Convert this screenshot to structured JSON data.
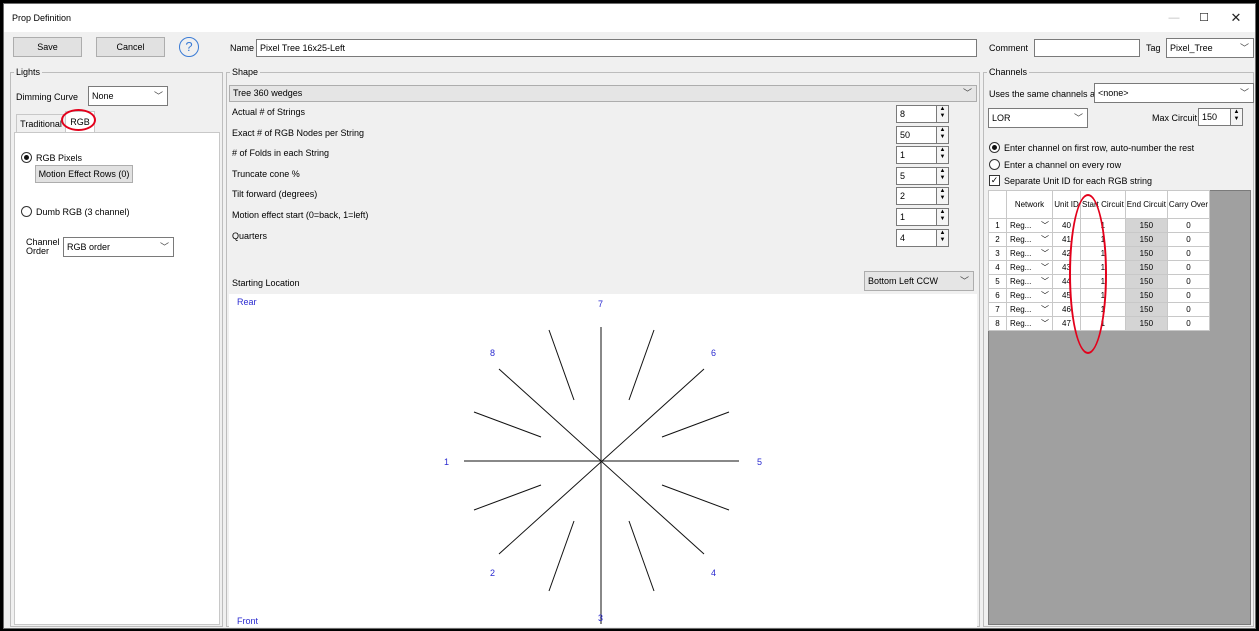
{
  "window": {
    "title": "Prop Definition",
    "min_icon": "—",
    "max_icon": "☐",
    "close_icon": "✕"
  },
  "toolbar": {
    "save_label": "Save",
    "cancel_label": "Cancel",
    "help_icon": "?"
  },
  "name": {
    "label": "Name",
    "value": "Pixel Tree 16x25-Left"
  },
  "comment": {
    "label": "Comment",
    "value": ""
  },
  "tag": {
    "label": "Tag",
    "value": "Pixel_Tree"
  },
  "lights": {
    "group_title": "Lights",
    "dimming_label": "Dimming Curve",
    "dimming_value": "None",
    "tabs": [
      "Traditional",
      "RGB"
    ],
    "active_tab": "RGB",
    "rgb_pixels_label": "RGB Pixels",
    "motion_rows_button": "Motion Effect Rows (0)",
    "dumb_rgb_label": "Dumb RGB (3 channel)",
    "channel_order_label_1": "Channel",
    "channel_order_label_2": "Order",
    "channel_order_value": "RGB order"
  },
  "shape": {
    "group_title": "Shape",
    "type_value": "Tree 360 wedges",
    "params": [
      {
        "label": "Actual # of Strings",
        "value": "8"
      },
      {
        "label": "Exact # of RGB Nodes per String",
        "value": "50"
      },
      {
        "label": "# of Folds in each String",
        "value": "1"
      },
      {
        "label": "Truncate cone %",
        "value": "5"
      },
      {
        "label": "Tilt forward (degrees)",
        "value": "2"
      },
      {
        "label": "Motion effect start (0=back, 1=left)",
        "value": "1"
      },
      {
        "label": "Quarters",
        "value": "4"
      }
    ],
    "starting_location_label": "Starting Location",
    "starting_location_value": "Bottom Left CCW",
    "canvas": {
      "rear_label": "Rear",
      "front_label": "Front",
      "numbers": [
        "7",
        "6",
        "5",
        "4",
        "3",
        "2",
        "1",
        "8"
      ]
    }
  },
  "channels": {
    "group_title": "Channels",
    "same_as_label": "Uses the same channels as",
    "same_as_value": "<none>",
    "network_type": "LOR",
    "max_circuit_label": "Max Circuit",
    "max_circuit_value": "150",
    "opt_first_row": "Enter channel on first row, auto-number the rest",
    "opt_every_row": "Enter a channel on every row",
    "opt_separate_unit": "Separate Unit ID for each RGB string",
    "grid": {
      "headers": [
        "",
        "Network",
        "Unit ID",
        "Start Circuit",
        "End Circuit",
        "Carry Over"
      ],
      "rows": [
        [
          "1",
          "Reg...",
          "40",
          "1",
          "150",
          "0"
        ],
        [
          "2",
          "Reg...",
          "41",
          "1",
          "150",
          "0"
        ],
        [
          "3",
          "Reg...",
          "42",
          "1",
          "150",
          "0"
        ],
        [
          "4",
          "Reg...",
          "43",
          "1",
          "150",
          "0"
        ],
        [
          "5",
          "Reg...",
          "44",
          "1",
          "150",
          "0"
        ],
        [
          "6",
          "Reg...",
          "45",
          "1",
          "150",
          "0"
        ],
        [
          "7",
          "Reg...",
          "46",
          "1",
          "150",
          "0"
        ],
        [
          "8",
          "Reg...",
          "47",
          "1",
          "150",
          "0"
        ]
      ]
    }
  },
  "annotation_color": "#e3001b"
}
